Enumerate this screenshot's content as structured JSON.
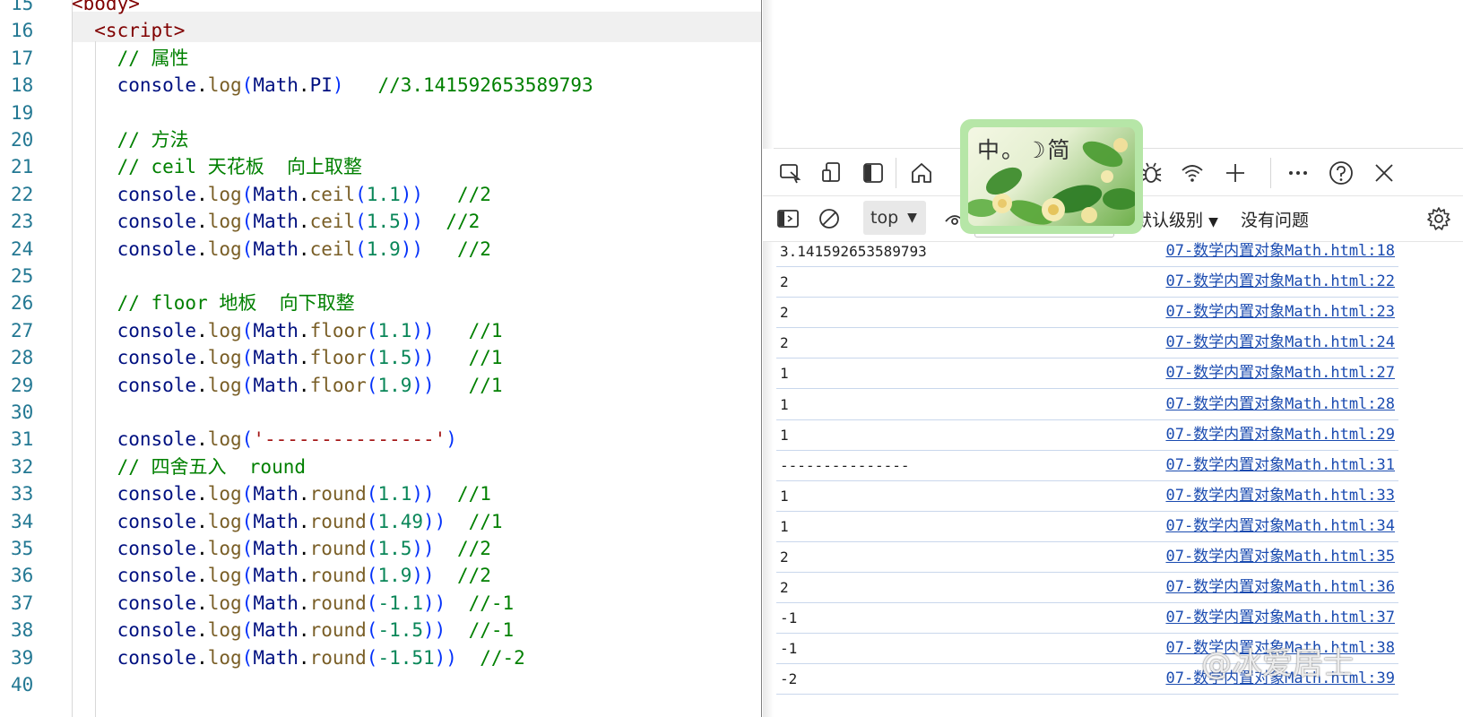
{
  "editor": {
    "lines": [
      {
        "n": "15",
        "tokens": [
          {
            "t": "<body>",
            "c": "tk-tag"
          }
        ]
      },
      {
        "n": "16",
        "tokens": [
          {
            "t": "  <script>",
            "c": "tk-tag"
          }
        ]
      },
      {
        "n": "17",
        "tokens": [
          {
            "t": "    // 属性",
            "c": "tk-cmt"
          }
        ]
      },
      {
        "n": "18",
        "tokens": [
          {
            "t": "    console",
            "c": "tk-obj"
          },
          {
            "t": ".",
            "c": "tk-punc"
          },
          {
            "t": "log",
            "c": "tk-fn"
          },
          {
            "t": "(",
            "c": "tk-paren"
          },
          {
            "t": "Math",
            "c": "tk-obj"
          },
          {
            "t": ".",
            "c": "tk-punc"
          },
          {
            "t": "PI",
            "c": "tk-prop"
          },
          {
            "t": ")",
            "c": "tk-paren"
          },
          {
            "t": "   //3.141592653589793",
            "c": "tk-cmt"
          }
        ]
      },
      {
        "n": "19",
        "tokens": []
      },
      {
        "n": "20",
        "tokens": [
          {
            "t": "    // 方法",
            "c": "tk-cmt"
          }
        ]
      },
      {
        "n": "21",
        "tokens": [
          {
            "t": "    // ceil 天花板  向上取整",
            "c": "tk-cmt"
          }
        ]
      },
      {
        "n": "22",
        "tokens": [
          {
            "t": "    console",
            "c": "tk-obj"
          },
          {
            "t": ".",
            "c": "tk-punc"
          },
          {
            "t": "log",
            "c": "tk-fn"
          },
          {
            "t": "(",
            "c": "tk-paren"
          },
          {
            "t": "Math",
            "c": "tk-obj"
          },
          {
            "t": ".",
            "c": "tk-punc"
          },
          {
            "t": "ceil",
            "c": "tk-fn"
          },
          {
            "t": "(",
            "c": "tk-paren"
          },
          {
            "t": "1.1",
            "c": "tk-num"
          },
          {
            "t": "))",
            "c": "tk-paren"
          },
          {
            "t": "   //2",
            "c": "tk-cmt"
          }
        ]
      },
      {
        "n": "23",
        "tokens": [
          {
            "t": "    console",
            "c": "tk-obj"
          },
          {
            "t": ".",
            "c": "tk-punc"
          },
          {
            "t": "log",
            "c": "tk-fn"
          },
          {
            "t": "(",
            "c": "tk-paren"
          },
          {
            "t": "Math",
            "c": "tk-obj"
          },
          {
            "t": ".",
            "c": "tk-punc"
          },
          {
            "t": "ceil",
            "c": "tk-fn"
          },
          {
            "t": "(",
            "c": "tk-paren"
          },
          {
            "t": "1.5",
            "c": "tk-num"
          },
          {
            "t": "))",
            "c": "tk-paren"
          },
          {
            "t": "  //2",
            "c": "tk-cmt"
          }
        ]
      },
      {
        "n": "24",
        "tokens": [
          {
            "t": "    console",
            "c": "tk-obj"
          },
          {
            "t": ".",
            "c": "tk-punc"
          },
          {
            "t": "log",
            "c": "tk-fn"
          },
          {
            "t": "(",
            "c": "tk-paren"
          },
          {
            "t": "Math",
            "c": "tk-obj"
          },
          {
            "t": ".",
            "c": "tk-punc"
          },
          {
            "t": "ceil",
            "c": "tk-fn"
          },
          {
            "t": "(",
            "c": "tk-paren"
          },
          {
            "t": "1.9",
            "c": "tk-num"
          },
          {
            "t": "))",
            "c": "tk-paren"
          },
          {
            "t": "   //2",
            "c": "tk-cmt"
          }
        ]
      },
      {
        "n": "25",
        "tokens": []
      },
      {
        "n": "26",
        "tokens": [
          {
            "t": "    // floor 地板  向下取整",
            "c": "tk-cmt"
          }
        ]
      },
      {
        "n": "27",
        "tokens": [
          {
            "t": "    console",
            "c": "tk-obj"
          },
          {
            "t": ".",
            "c": "tk-punc"
          },
          {
            "t": "log",
            "c": "tk-fn"
          },
          {
            "t": "(",
            "c": "tk-paren"
          },
          {
            "t": "Math",
            "c": "tk-obj"
          },
          {
            "t": ".",
            "c": "tk-punc"
          },
          {
            "t": "floor",
            "c": "tk-fn"
          },
          {
            "t": "(",
            "c": "tk-paren"
          },
          {
            "t": "1.1",
            "c": "tk-num"
          },
          {
            "t": "))",
            "c": "tk-paren"
          },
          {
            "t": "   //1",
            "c": "tk-cmt"
          }
        ]
      },
      {
        "n": "28",
        "tokens": [
          {
            "t": "    console",
            "c": "tk-obj"
          },
          {
            "t": ".",
            "c": "tk-punc"
          },
          {
            "t": "log",
            "c": "tk-fn"
          },
          {
            "t": "(",
            "c": "tk-paren"
          },
          {
            "t": "Math",
            "c": "tk-obj"
          },
          {
            "t": ".",
            "c": "tk-punc"
          },
          {
            "t": "floor",
            "c": "tk-fn"
          },
          {
            "t": "(",
            "c": "tk-paren"
          },
          {
            "t": "1.5",
            "c": "tk-num"
          },
          {
            "t": "))",
            "c": "tk-paren"
          },
          {
            "t": "   //1",
            "c": "tk-cmt"
          }
        ]
      },
      {
        "n": "29",
        "tokens": [
          {
            "t": "    console",
            "c": "tk-obj"
          },
          {
            "t": ".",
            "c": "tk-punc"
          },
          {
            "t": "log",
            "c": "tk-fn"
          },
          {
            "t": "(",
            "c": "tk-paren"
          },
          {
            "t": "Math",
            "c": "tk-obj"
          },
          {
            "t": ".",
            "c": "tk-punc"
          },
          {
            "t": "floor",
            "c": "tk-fn"
          },
          {
            "t": "(",
            "c": "tk-paren"
          },
          {
            "t": "1.9",
            "c": "tk-num"
          },
          {
            "t": "))",
            "c": "tk-paren"
          },
          {
            "t": "   //1",
            "c": "tk-cmt"
          }
        ]
      },
      {
        "n": "30",
        "tokens": []
      },
      {
        "n": "31",
        "tokens": [
          {
            "t": "    console",
            "c": "tk-obj"
          },
          {
            "t": ".",
            "c": "tk-punc"
          },
          {
            "t": "log",
            "c": "tk-fn"
          },
          {
            "t": "(",
            "c": "tk-paren"
          },
          {
            "t": "'---------------'",
            "c": "tk-str"
          },
          {
            "t": ")",
            "c": "tk-paren"
          }
        ]
      },
      {
        "n": "32",
        "tokens": [
          {
            "t": "    // 四舍五入  round",
            "c": "tk-cmt"
          }
        ]
      },
      {
        "n": "33",
        "tokens": [
          {
            "t": "    console",
            "c": "tk-obj"
          },
          {
            "t": ".",
            "c": "tk-punc"
          },
          {
            "t": "log",
            "c": "tk-fn"
          },
          {
            "t": "(",
            "c": "tk-paren"
          },
          {
            "t": "Math",
            "c": "tk-obj"
          },
          {
            "t": ".",
            "c": "tk-punc"
          },
          {
            "t": "round",
            "c": "tk-fn"
          },
          {
            "t": "(",
            "c": "tk-paren"
          },
          {
            "t": "1.1",
            "c": "tk-num"
          },
          {
            "t": "))",
            "c": "tk-paren"
          },
          {
            "t": "  //1",
            "c": "tk-cmt"
          }
        ]
      },
      {
        "n": "34",
        "tokens": [
          {
            "t": "    console",
            "c": "tk-obj"
          },
          {
            "t": ".",
            "c": "tk-punc"
          },
          {
            "t": "log",
            "c": "tk-fn"
          },
          {
            "t": "(",
            "c": "tk-paren"
          },
          {
            "t": "Math",
            "c": "tk-obj"
          },
          {
            "t": ".",
            "c": "tk-punc"
          },
          {
            "t": "round",
            "c": "tk-fn"
          },
          {
            "t": "(",
            "c": "tk-paren"
          },
          {
            "t": "1.49",
            "c": "tk-num"
          },
          {
            "t": "))",
            "c": "tk-paren"
          },
          {
            "t": "  //1",
            "c": "tk-cmt"
          }
        ]
      },
      {
        "n": "35",
        "tokens": [
          {
            "t": "    console",
            "c": "tk-obj"
          },
          {
            "t": ".",
            "c": "tk-punc"
          },
          {
            "t": "log",
            "c": "tk-fn"
          },
          {
            "t": "(",
            "c": "tk-paren"
          },
          {
            "t": "Math",
            "c": "tk-obj"
          },
          {
            "t": ".",
            "c": "tk-punc"
          },
          {
            "t": "round",
            "c": "tk-fn"
          },
          {
            "t": "(",
            "c": "tk-paren"
          },
          {
            "t": "1.5",
            "c": "tk-num"
          },
          {
            "t": "))",
            "c": "tk-paren"
          },
          {
            "t": "  //2",
            "c": "tk-cmt"
          }
        ]
      },
      {
        "n": "36",
        "tokens": [
          {
            "t": "    console",
            "c": "tk-obj"
          },
          {
            "t": ".",
            "c": "tk-punc"
          },
          {
            "t": "log",
            "c": "tk-fn"
          },
          {
            "t": "(",
            "c": "tk-paren"
          },
          {
            "t": "Math",
            "c": "tk-obj"
          },
          {
            "t": ".",
            "c": "tk-punc"
          },
          {
            "t": "round",
            "c": "tk-fn"
          },
          {
            "t": "(",
            "c": "tk-paren"
          },
          {
            "t": "1.9",
            "c": "tk-num"
          },
          {
            "t": "))",
            "c": "tk-paren"
          },
          {
            "t": "  //2",
            "c": "tk-cmt"
          }
        ]
      },
      {
        "n": "37",
        "tokens": [
          {
            "t": "    console",
            "c": "tk-obj"
          },
          {
            "t": ".",
            "c": "tk-punc"
          },
          {
            "t": "log",
            "c": "tk-fn"
          },
          {
            "t": "(",
            "c": "tk-paren"
          },
          {
            "t": "Math",
            "c": "tk-obj"
          },
          {
            "t": ".",
            "c": "tk-punc"
          },
          {
            "t": "round",
            "c": "tk-fn"
          },
          {
            "t": "(",
            "c": "tk-paren"
          },
          {
            "t": "-1.1",
            "c": "tk-num"
          },
          {
            "t": "))",
            "c": "tk-paren"
          },
          {
            "t": "  //-1",
            "c": "tk-cmt"
          }
        ]
      },
      {
        "n": "38",
        "tokens": [
          {
            "t": "    console",
            "c": "tk-obj"
          },
          {
            "t": ".",
            "c": "tk-punc"
          },
          {
            "t": "log",
            "c": "tk-fn"
          },
          {
            "t": "(",
            "c": "tk-paren"
          },
          {
            "t": "Math",
            "c": "tk-obj"
          },
          {
            "t": ".",
            "c": "tk-punc"
          },
          {
            "t": "round",
            "c": "tk-fn"
          },
          {
            "t": "(",
            "c": "tk-paren"
          },
          {
            "t": "-1.5",
            "c": "tk-num"
          },
          {
            "t": "))",
            "c": "tk-paren"
          },
          {
            "t": "  //-1",
            "c": "tk-cmt"
          }
        ]
      },
      {
        "n": "39",
        "tokens": [
          {
            "t": "    console",
            "c": "tk-obj"
          },
          {
            "t": ".",
            "c": "tk-punc"
          },
          {
            "t": "log",
            "c": "tk-fn"
          },
          {
            "t": "(",
            "c": "tk-paren"
          },
          {
            "t": "Math",
            "c": "tk-obj"
          },
          {
            "t": ".",
            "c": "tk-punc"
          },
          {
            "t": "round",
            "c": "tk-fn"
          },
          {
            "t": "(",
            "c": "tk-paren"
          },
          {
            "t": "-1.51",
            "c": "tk-num"
          },
          {
            "t": "))",
            "c": "tk-paren"
          },
          {
            "t": "  //-2",
            "c": "tk-cmt"
          }
        ]
      },
      {
        "n": "40",
        "tokens": []
      }
    ]
  },
  "devtools": {
    "toolbar_icons": [
      "inspect-icon",
      "device-emulation-icon",
      "sidebar-icon",
      "home-icon",
      "bug-icon",
      "wifi-icon",
      "add-icon",
      "more-icon",
      "help-icon",
      "close-icon"
    ],
    "console": {
      "context_value": "top",
      "level_label": "默认级别",
      "issues_label": "没有问题"
    },
    "rows": [
      {
        "msg": "3.141592653589793",
        "src": "07-数学内置对象Math.html:18"
      },
      {
        "msg": "2",
        "src": "07-数学内置对象Math.html:22"
      },
      {
        "msg": "2",
        "src": "07-数学内置对象Math.html:23"
      },
      {
        "msg": "2",
        "src": "07-数学内置对象Math.html:24"
      },
      {
        "msg": "1",
        "src": "07-数学内置对象Math.html:27"
      },
      {
        "msg": "1",
        "src": "07-数学内置对象Math.html:28"
      },
      {
        "msg": "1",
        "src": "07-数学内置对象Math.html:29"
      },
      {
        "msg": "---------------",
        "src": "07-数学内置对象Math.html:31"
      },
      {
        "msg": "1",
        "src": "07-数学内置对象Math.html:33"
      },
      {
        "msg": "1",
        "src": "07-数学内置对象Math.html:34"
      },
      {
        "msg": "2",
        "src": "07-数学内置对象Math.html:35"
      },
      {
        "msg": "2",
        "src": "07-数学内置对象Math.html:36"
      },
      {
        "msg": "-1",
        "src": "07-数学内置对象Math.html:37"
      },
      {
        "msg": "-1",
        "src": "07-数学内置对象Math.html:38"
      },
      {
        "msg": "-2",
        "src": "07-数学内置对象Math.html:39"
      }
    ]
  },
  "widget": {
    "text": "中。☽简"
  },
  "watermark": {
    "text": "@冰爱居士"
  },
  "colors": {
    "accent": "#0f6cbd",
    "comment": "#008000",
    "line_number": "#237893"
  }
}
